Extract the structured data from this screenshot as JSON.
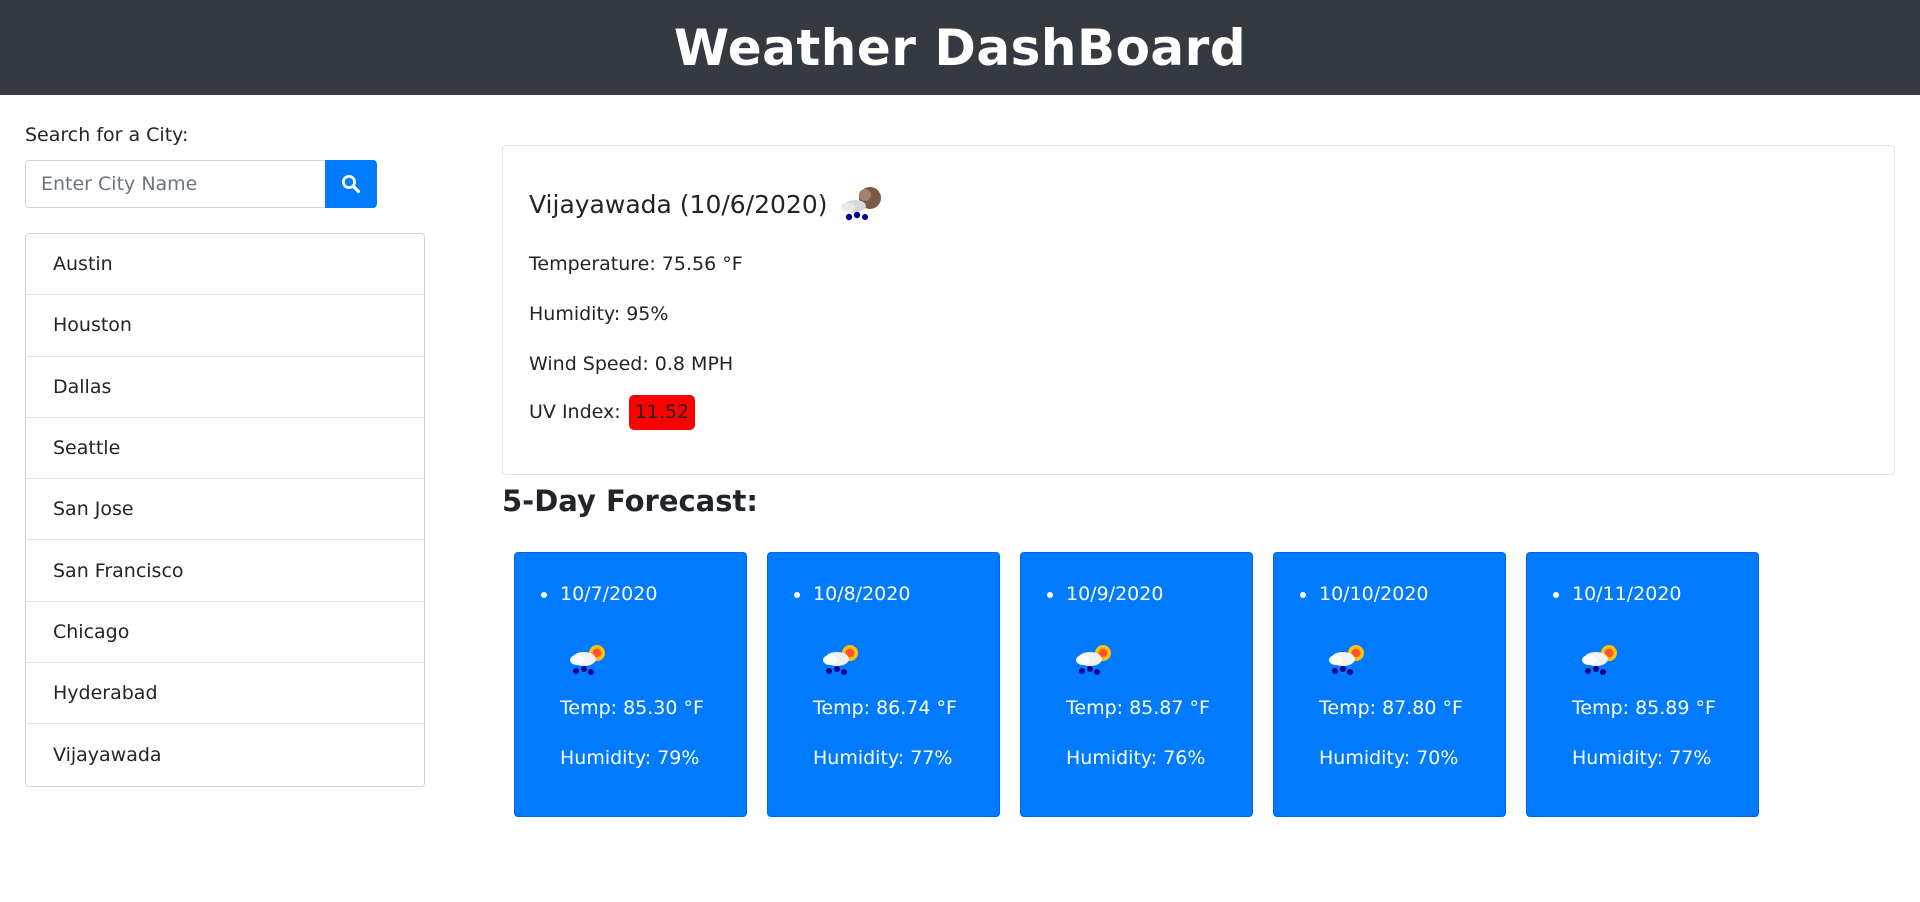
{
  "header": {
    "title": "Weather DashBoard"
  },
  "search": {
    "label": "Search for a City:",
    "placeholder": "Enter City Name",
    "value": "",
    "button_icon": "search-icon"
  },
  "cities": [
    "Austin",
    "Houston",
    "Dallas",
    "Seattle",
    "San Jose",
    "San Francisco",
    "Chicago",
    "Hyderabad",
    "Vijayawada"
  ],
  "current": {
    "title": "Vijayawada (10/6/2020)",
    "icon": "rain-cloud-icon",
    "temperature": "Temperature: 75.56 °F",
    "humidity": "Humidity: 95%",
    "wind": "Wind Speed: 0.8 MPH",
    "uv_label": "UV Index:",
    "uv_value": "11.52",
    "uv_color": "#ff0000"
  },
  "forecast": {
    "title": "5-Day Forecast:",
    "days": [
      {
        "date": "10/7/2020",
        "icon": "sun-rain-cloud-icon",
        "temp": "Temp: 85.30 °F",
        "humidity": "Humidity: 79%"
      },
      {
        "date": "10/8/2020",
        "icon": "sun-rain-cloud-icon",
        "temp": "Temp: 86.74 °F",
        "humidity": "Humidity: 77%"
      },
      {
        "date": "10/9/2020",
        "icon": "sun-rain-cloud-icon",
        "temp": "Temp: 85.87 °F",
        "humidity": "Humidity: 76%"
      },
      {
        "date": "10/10/2020",
        "icon": "sun-rain-cloud-icon",
        "temp": "Temp: 87.80 °F",
        "humidity": "Humidity: 70%"
      },
      {
        "date": "10/11/2020",
        "icon": "sun-rain-cloud-icon",
        "temp": "Temp: 85.89 °F",
        "humidity": "Humidity: 77%"
      }
    ]
  },
  "colors": {
    "header_bg": "#343a40",
    "accent": "#007bff"
  }
}
